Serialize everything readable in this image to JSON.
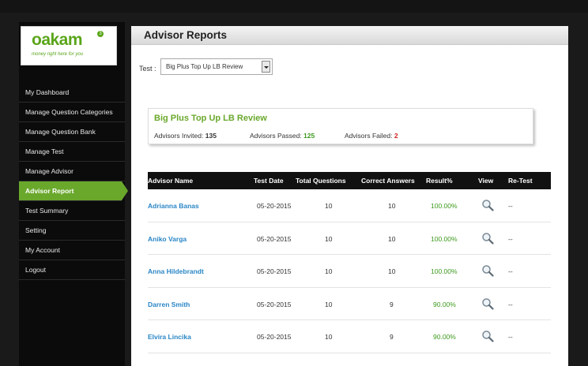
{
  "logo": {
    "name": "oakam",
    "tagline": "money right here for you",
    "badge": "3"
  },
  "sidebar": {
    "items": [
      {
        "label": "My Dashboard",
        "active": false
      },
      {
        "label": "Manage Question Categories",
        "active": false
      },
      {
        "label": "Manage Question Bank",
        "active": false
      },
      {
        "label": "Manage Test",
        "active": false
      },
      {
        "label": "Manage Advisor",
        "active": false
      },
      {
        "label": "Advisor Report",
        "active": true
      },
      {
        "label": "Test Summary",
        "active": false
      },
      {
        "label": "Setting",
        "active": false
      },
      {
        "label": "My Account",
        "active": false
      },
      {
        "label": "Logout",
        "active": false
      }
    ]
  },
  "page": {
    "title": "Advisor Reports"
  },
  "filter": {
    "label": "Test :",
    "selected": "Big Plus Top Up LB Review"
  },
  "summary": {
    "title": "Big Plus Top Up LB Review",
    "invited_label": "Advisors Invited:",
    "invited": "135",
    "passed_label": "Advisors Passed:",
    "passed": "125",
    "failed_label": "Advisors Failed:",
    "failed": "2"
  },
  "table": {
    "headers": {
      "name": "Advisor Name",
      "date": "Test Date",
      "total": "Total Questions",
      "correct": "Correct Answers",
      "result": "Result%",
      "view": "View",
      "retest": "Re-Test"
    },
    "rows": [
      {
        "name": "Adrianna Banas",
        "date": "05-20-2015",
        "total": "10",
        "correct": "10",
        "result": "100.00%",
        "retest": "--"
      },
      {
        "name": "Aniko Varga",
        "date": "05-20-2015",
        "total": "10",
        "correct": "10",
        "result": "100.00%",
        "retest": "--"
      },
      {
        "name": "Anna Hildebrandt",
        "date": "05-20-2015",
        "total": "10",
        "correct": "10",
        "result": "100.00%",
        "retest": "--"
      },
      {
        "name": "Darren Smith",
        "date": "05-20-2015",
        "total": "10",
        "correct": "9",
        "result": "90.00%",
        "retest": "--"
      },
      {
        "name": "Elvira Lincika",
        "date": "05-20-2015",
        "total": "10",
        "correct": "9",
        "result": "90.00%",
        "retest": "--"
      }
    ]
  },
  "colors": {
    "accent": "#6aa82c",
    "link": "#2a86c6",
    "pass": "#3d9a1e",
    "fail": "#d22222"
  }
}
